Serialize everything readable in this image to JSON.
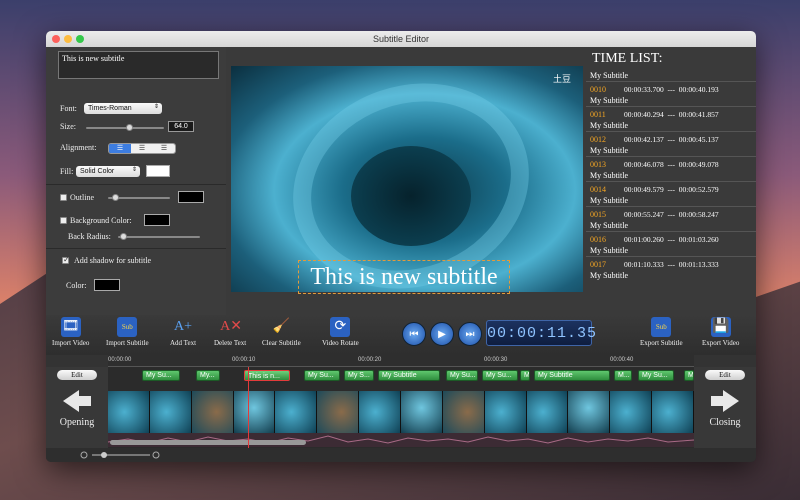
{
  "window": {
    "title": "Subtitle Editor"
  },
  "left_panel": {
    "subtitle_text": "This  is new subtitle",
    "font_label": "Font:",
    "font_value": "Times-Roman",
    "size_label": "Size:",
    "size_value": "64.0",
    "size_level": 0.55,
    "alignment_label": "Alignment:",
    "fill_label": "Fill:",
    "fill_value": "Solid Color",
    "outline_label": "Outline",
    "background_color_label": "Background Color:",
    "back_radius_label": "Back Radius:",
    "shadow_label": "Add shadow for subtitle",
    "color_label": "Color:"
  },
  "video": {
    "logo_text": "土豆",
    "subtitle_overlay": "This  is new subtitle"
  },
  "time_list": {
    "title": "TIME LIST:",
    "first_name": "My Subtitle",
    "rows": [
      {
        "num": "0010",
        "start": "00:00:33.700",
        "sep": "---",
        "end": "00:00:40.193",
        "name": "My Subtitle"
      },
      {
        "num": "0011",
        "start": "00:00:40.294",
        "sep": "---",
        "end": "00:00:41.857",
        "name": "My Subtitle"
      },
      {
        "num": "0012",
        "start": "00:00:42.137",
        "sep": "---",
        "end": "00:00:45.137",
        "name": "My Subtitle"
      },
      {
        "num": "0013",
        "start": "00:00:46.078",
        "sep": "---",
        "end": "00:00:49.078",
        "name": "My Subtitle"
      },
      {
        "num": "0014",
        "start": "00:00:49.579",
        "sep": "---",
        "end": "00:00:52.579",
        "name": "My Subtitle"
      },
      {
        "num": "0015",
        "start": "00:00:55.247",
        "sep": "---",
        "end": "00:00:58.247",
        "name": "My Subtitle"
      },
      {
        "num": "0016",
        "start": "00:01:00.260",
        "sep": "---",
        "end": "00:01:03.260",
        "name": "My Subtitle"
      },
      {
        "num": "0017",
        "start": "00:01:10.333",
        "sep": "---",
        "end": "00:01:13.333",
        "name": "My Subtitle"
      }
    ]
  },
  "toolbar": {
    "import_video": "Import Video",
    "import_subtitle": "Import Subtitle",
    "add_text": "Add Text",
    "delete_text": "Delete Text",
    "clear_subtitle": "Clear Subtitle",
    "video_rotate": "Video Rotate",
    "time_display": "00:00:11.35",
    "export_subtitle": "Export Subtitle",
    "export_video": "Export Video"
  },
  "timeline": {
    "ruler_ticks": [
      "00:00:00",
      "00:00:10",
      "00:00:20",
      "00:00:30",
      "00:00:40"
    ],
    "edit_left": "Edit",
    "edit_right": "Edit",
    "opening": "Opening",
    "closing": "Closing",
    "clips": [
      "My Su...",
      "My...",
      "This  is n...",
      "My Su...",
      "My S...",
      "My Subtitle",
      "My Su...",
      "My Su...",
      "M",
      "My Subtitle",
      "M...",
      "My Su...",
      "M"
    ]
  },
  "colors": {
    "accent": "#3d7de0",
    "clip": "#4caf50",
    "selected_clip_border": "#e23b3b",
    "row_number": "#f5a623"
  }
}
